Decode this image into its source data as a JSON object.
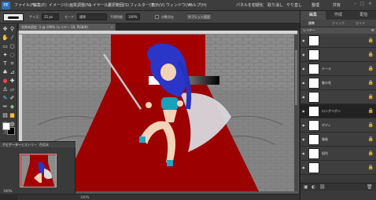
{
  "app": {
    "logo": "PE",
    "menu": [
      "ファイル(F)",
      "編集(E)",
      "イメージ(I)",
      "画質調整(N)",
      "レイヤー(L)",
      "選択範囲(S)",
      "フィルター(T)",
      "表示(V)",
      "ウィンドウ(W)",
      "ヘルプ(H)"
    ],
    "right_items": [
      "パネルを初期化",
      "取り消し",
      "やり直し",
      "整理",
      "共有"
    ]
  },
  "options": {
    "size_label": "サイズ：",
    "size_value": "15 px",
    "mode_label": "モード：",
    "mode_value": "通常",
    "opacity_label": "不透明度：",
    "opacity_value": "100%",
    "autoerase_label": "自動消去",
    "tablet_label": "タブレット設定"
  },
  "document": {
    "tab_title": "名称未設定 -1 @ 100% (レイヤー 10, RGB/8)",
    "status": "100%"
  },
  "panels": {
    "tabs": [
      "編集",
      "作成",
      "配信"
    ],
    "subtabs": [
      "標準",
      "クイック",
      "ガイド"
    ],
    "layers_title": "レイヤー",
    "layers": [
      {
        "name": "",
        "active": false
      },
      {
        "name": "",
        "active": false
      },
      {
        "name": "テール",
        "active": false
      },
      {
        "name": "髪の毛",
        "active": false
      },
      {
        "name": "",
        "active": false
      },
      {
        "name": "ロングリボン",
        "active": true
      },
      {
        "name": "ボディ",
        "active": false
      },
      {
        "name": "服装",
        "active": false
      },
      {
        "name": "肌色",
        "active": false
      },
      {
        "name": "",
        "active": false
      },
      {
        "name": "",
        "active": false
      }
    ]
  },
  "navigator": {
    "tabs": [
      "ナビゲーター",
      "ヒストリー",
      "色見本"
    ],
    "zoom": "100%"
  },
  "colors": {
    "red_carpet": "#a50000",
    "accent_blue": "#2a6fc0"
  }
}
